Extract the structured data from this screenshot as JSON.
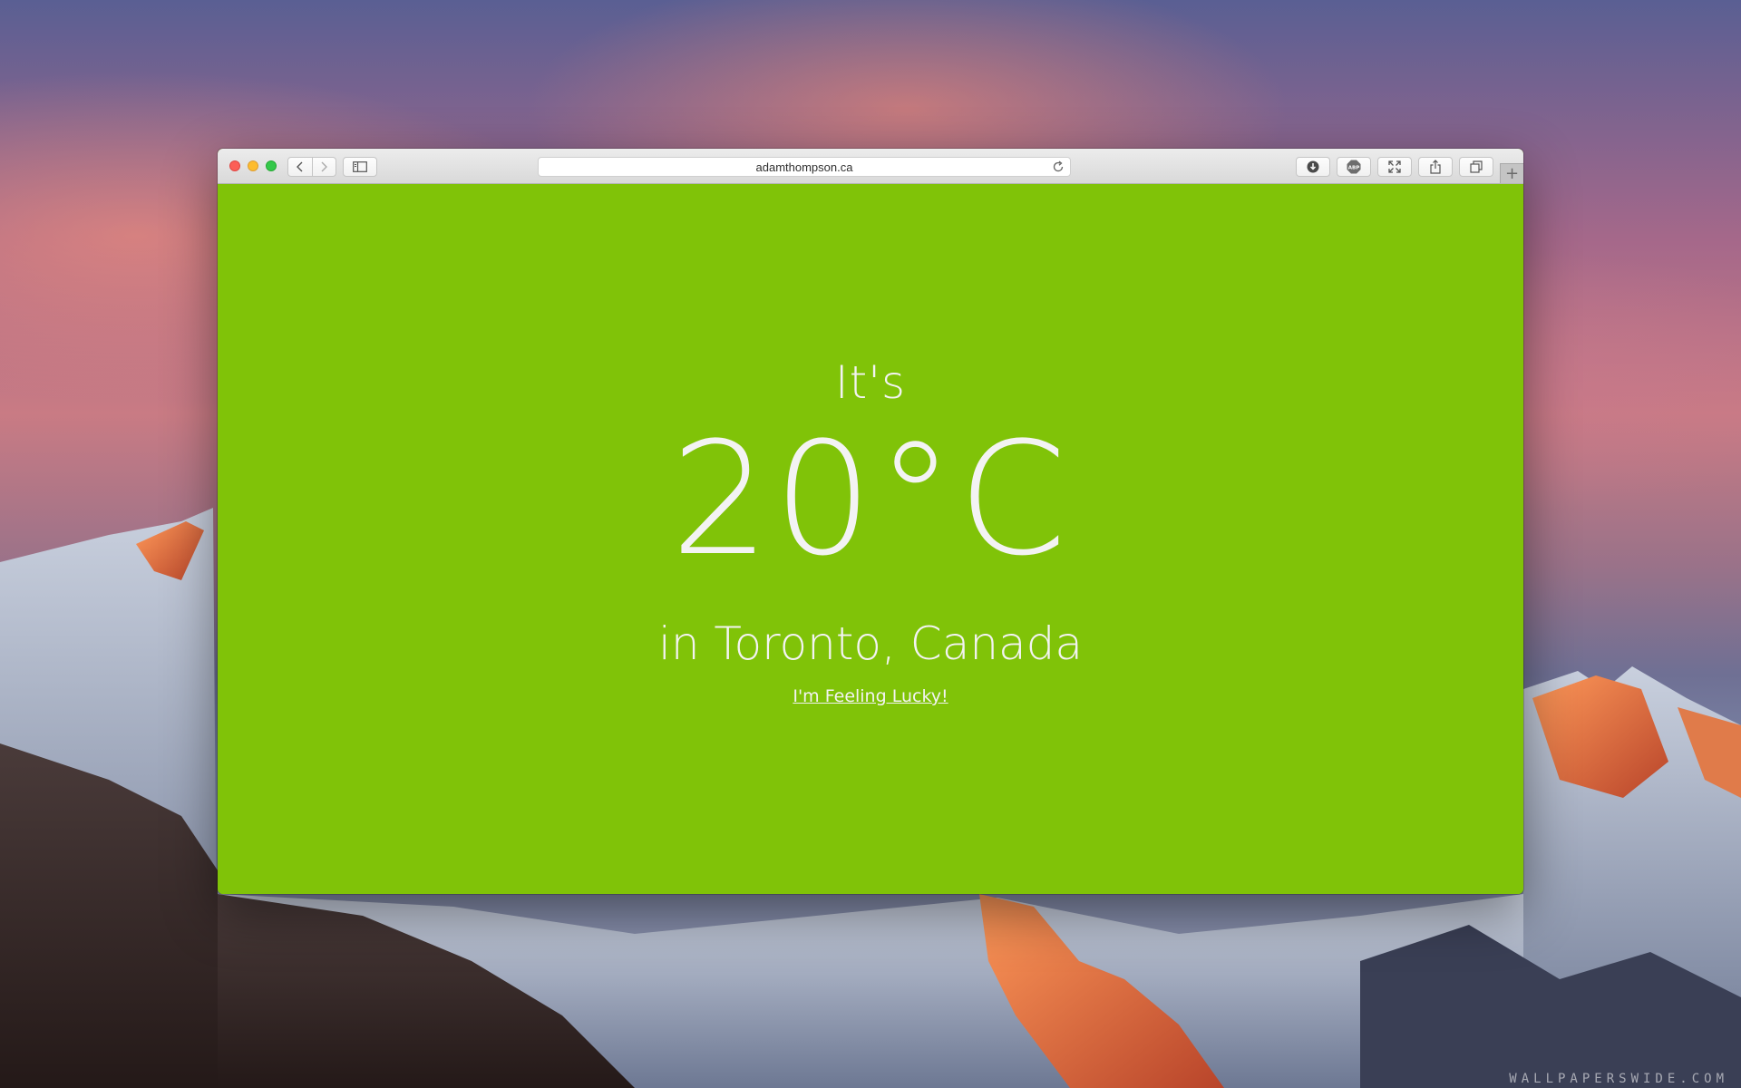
{
  "browser": {
    "url": "adamthompson.ca",
    "toolbar_icons": [
      "download-icon",
      "adblock-icon",
      "fullscreen-icon",
      "share-icon",
      "tabs-overview-icon"
    ],
    "new_tab_label": "+"
  },
  "page": {
    "background_color": "#80c308",
    "intro": "It's",
    "temperature": "20°C",
    "location": "in Toronto, Canada",
    "lucky_link": "I'm Feeling Lucky!"
  },
  "wallpaper": {
    "watermark": "WALLPAPERSWIDE.COM"
  }
}
